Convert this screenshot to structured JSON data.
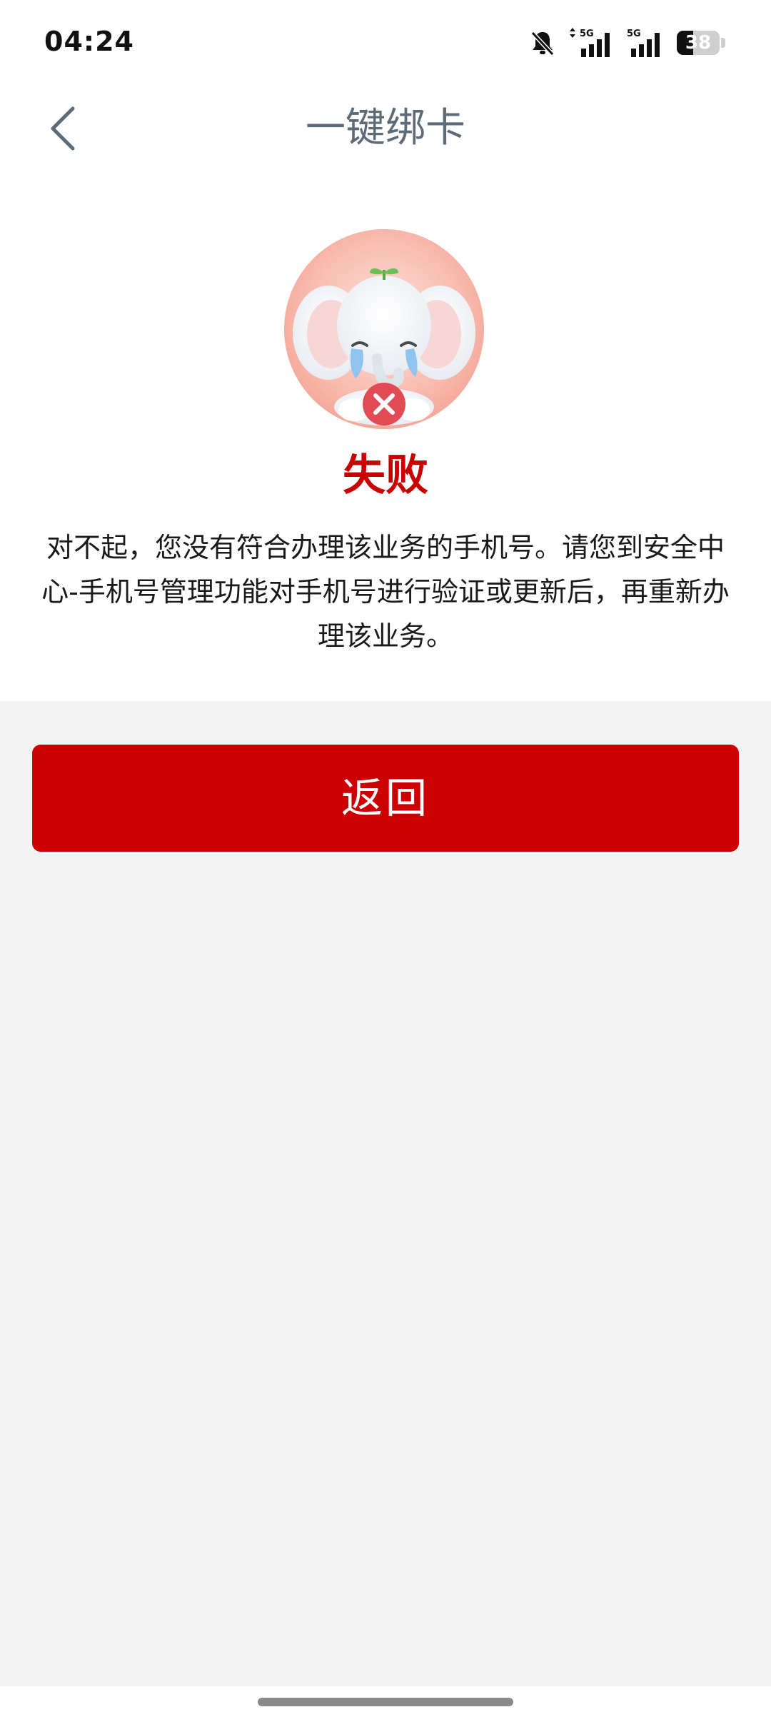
{
  "status_bar": {
    "time": "04:24",
    "network_1": "5G",
    "network_2": "5G",
    "battery_level": "38",
    "battery_percent": 38,
    "icons": [
      "bell-muted-icon",
      "signal-5g-icon",
      "signal-5g-icon",
      "battery-icon"
    ]
  },
  "nav": {
    "back_icon": "chevron-left-icon",
    "title": "一键绑卡"
  },
  "result": {
    "illustration": "crying-elephant-failure-icon",
    "title": "失败",
    "message": "对不起，您没有符合办理该业务的手机号。请您到安全中心-手机号管理功能对手机号进行验证或更新后，再重新办理该业务。"
  },
  "actions": {
    "back_button_label": "返回"
  },
  "colors": {
    "accent_red": "#cc0000",
    "title_red": "#c90000",
    "nav_title": "#5d6b78",
    "page_background": "#f3f3f3"
  }
}
